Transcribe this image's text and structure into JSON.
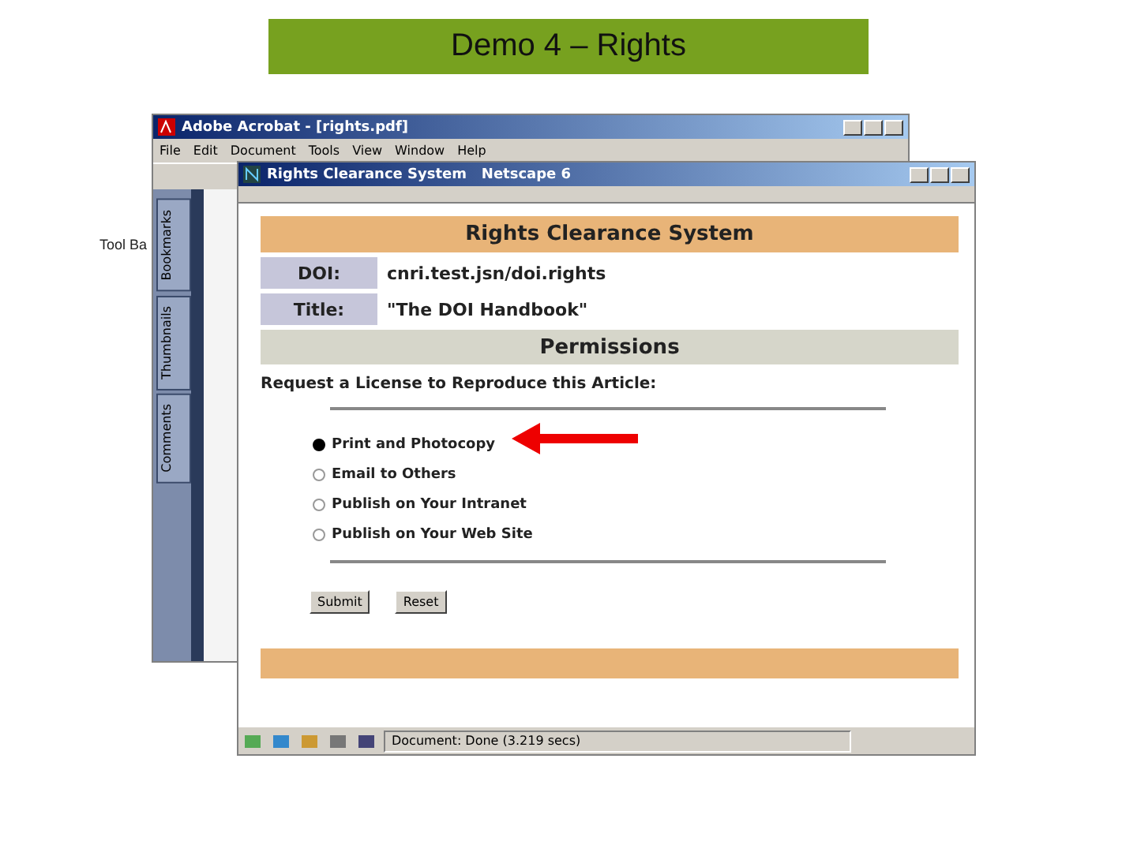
{
  "slide": {
    "title": "Demo 4 – Rights",
    "side_label": "Tool Ba"
  },
  "acrobat": {
    "title": "Adobe Acrobat - [rights.pdf]",
    "menu": [
      "File",
      "Edit",
      "Document",
      "Tools",
      "View",
      "Window",
      "Help"
    ],
    "side_tabs": [
      "Bookmarks",
      "Thumbnails",
      "Comments"
    ]
  },
  "browser": {
    "title": "Rights Clearance System   Netscape 6",
    "page": {
      "heading": "Rights Clearance System",
      "fields": [
        {
          "label": "DOI:",
          "value": "cnri.test.jsn/doi.rights"
        },
        {
          "label": "Title:",
          "value": "\"The DOI Handbook\""
        }
      ],
      "section": "Permissions",
      "prompt": "Request a License to Reproduce this Article:",
      "options": [
        {
          "label": "Print and Photocopy",
          "selected": true
        },
        {
          "label": "Email to Others",
          "selected": false
        },
        {
          "label": "Publish on Your Intranet",
          "selected": false
        },
        {
          "label": "Publish on Your Web Site",
          "selected": false
        }
      ],
      "buttons": [
        "Submit",
        "Reset"
      ]
    },
    "status": "Document: Done (3.219 secs)"
  }
}
